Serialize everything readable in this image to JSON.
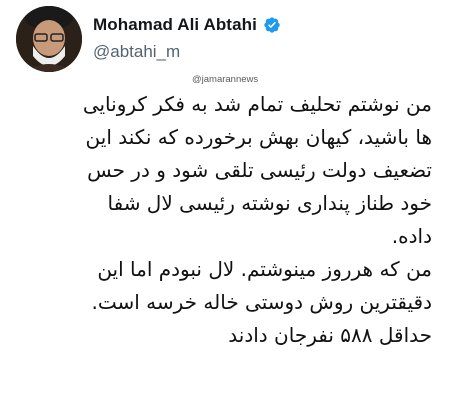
{
  "author": {
    "display_name": "Mohamad Ali Abtahi",
    "handle": "@abtahi_m",
    "avatar_icon": "user-avatar",
    "verified_icon": "verified-badge-icon",
    "verified_color": "#1d9bf0"
  },
  "watermark": "@jamarannews",
  "tweet": {
    "lines": [
      "من نوشتم تحلیف تمام شد به فکر کرونایی",
      "ها باشید، کیهان بهش برخورده که نکند این",
      "تضعیف دولت رئیسی تلقی شود و در حس",
      "خود طناز پنداری نوشته رئیسی لال شفا",
      "داده.",
      "من که هرروز مینوشتم. لال نبودم اما این",
      "دقیقترین روش دوستی خاله خرسه است.",
      "حداقل ۵۸۸ نفرجان دادند"
    ]
  }
}
